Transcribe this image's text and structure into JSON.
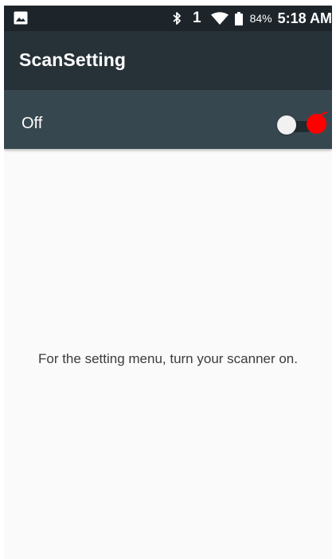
{
  "status_bar": {
    "icons": [
      "image-icon",
      "bluetooth-icon",
      "wifi-icon",
      "battery-icon"
    ],
    "sim_slot": "1",
    "battery_percent": "84%",
    "time": "5:18 AM"
  },
  "app_bar": {
    "title": "ScanSetting"
  },
  "scanner_switch": {
    "label": "Off",
    "state": "off"
  },
  "message": "For the setting menu, turn your scanner on.",
  "colors": {
    "status_bar": "#1d252b",
    "app_bar": "#263238",
    "switch_bar": "#37474f",
    "background": "#fafafa",
    "touch_marker": "#ff0000"
  }
}
